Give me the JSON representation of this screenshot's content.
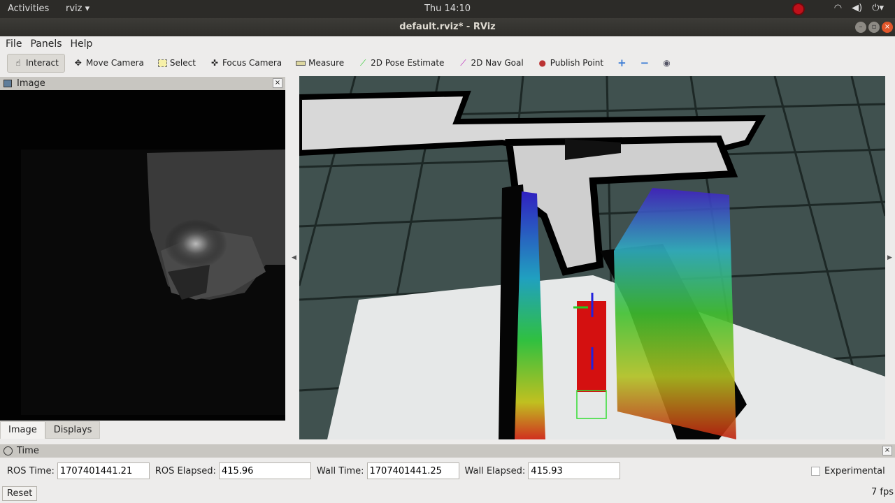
{
  "system": {
    "activities": "Activities",
    "app": "rviz",
    "clock": "Thu 14:10"
  },
  "window": {
    "title": "default.rviz* - RViz"
  },
  "menu": [
    "File",
    "Panels",
    "Help"
  ],
  "toolbar": [
    {
      "label": "Interact",
      "icon": "hand-icon"
    },
    {
      "label": "Move Camera",
      "icon": "move-icon"
    },
    {
      "label": "Select",
      "icon": "select-icon"
    },
    {
      "label": "Focus Camera",
      "icon": "focus-icon"
    },
    {
      "label": "Measure",
      "icon": "ruler-icon"
    },
    {
      "label": "2D Pose Estimate",
      "icon": "green-arrow-icon"
    },
    {
      "label": "2D Nav Goal",
      "icon": "purple-arrow-icon"
    },
    {
      "label": "Publish Point",
      "icon": "pin-icon"
    }
  ],
  "image_panel": {
    "title": "Image"
  },
  "tabs": [
    "Image",
    "Displays"
  ],
  "time_panel": {
    "title": "Time",
    "ros_time_label": "ROS Time:",
    "ros_time": "1707401441.21",
    "ros_elapsed_label": "ROS Elapsed:",
    "ros_elapsed": "415.96",
    "wall_time_label": "Wall Time:",
    "wall_time": "1707401441.25",
    "wall_elapsed_label": "Wall Elapsed:",
    "wall_elapsed": "415.93",
    "experimental": "Experimental"
  },
  "reset": "Reset",
  "fps": "7 fps"
}
